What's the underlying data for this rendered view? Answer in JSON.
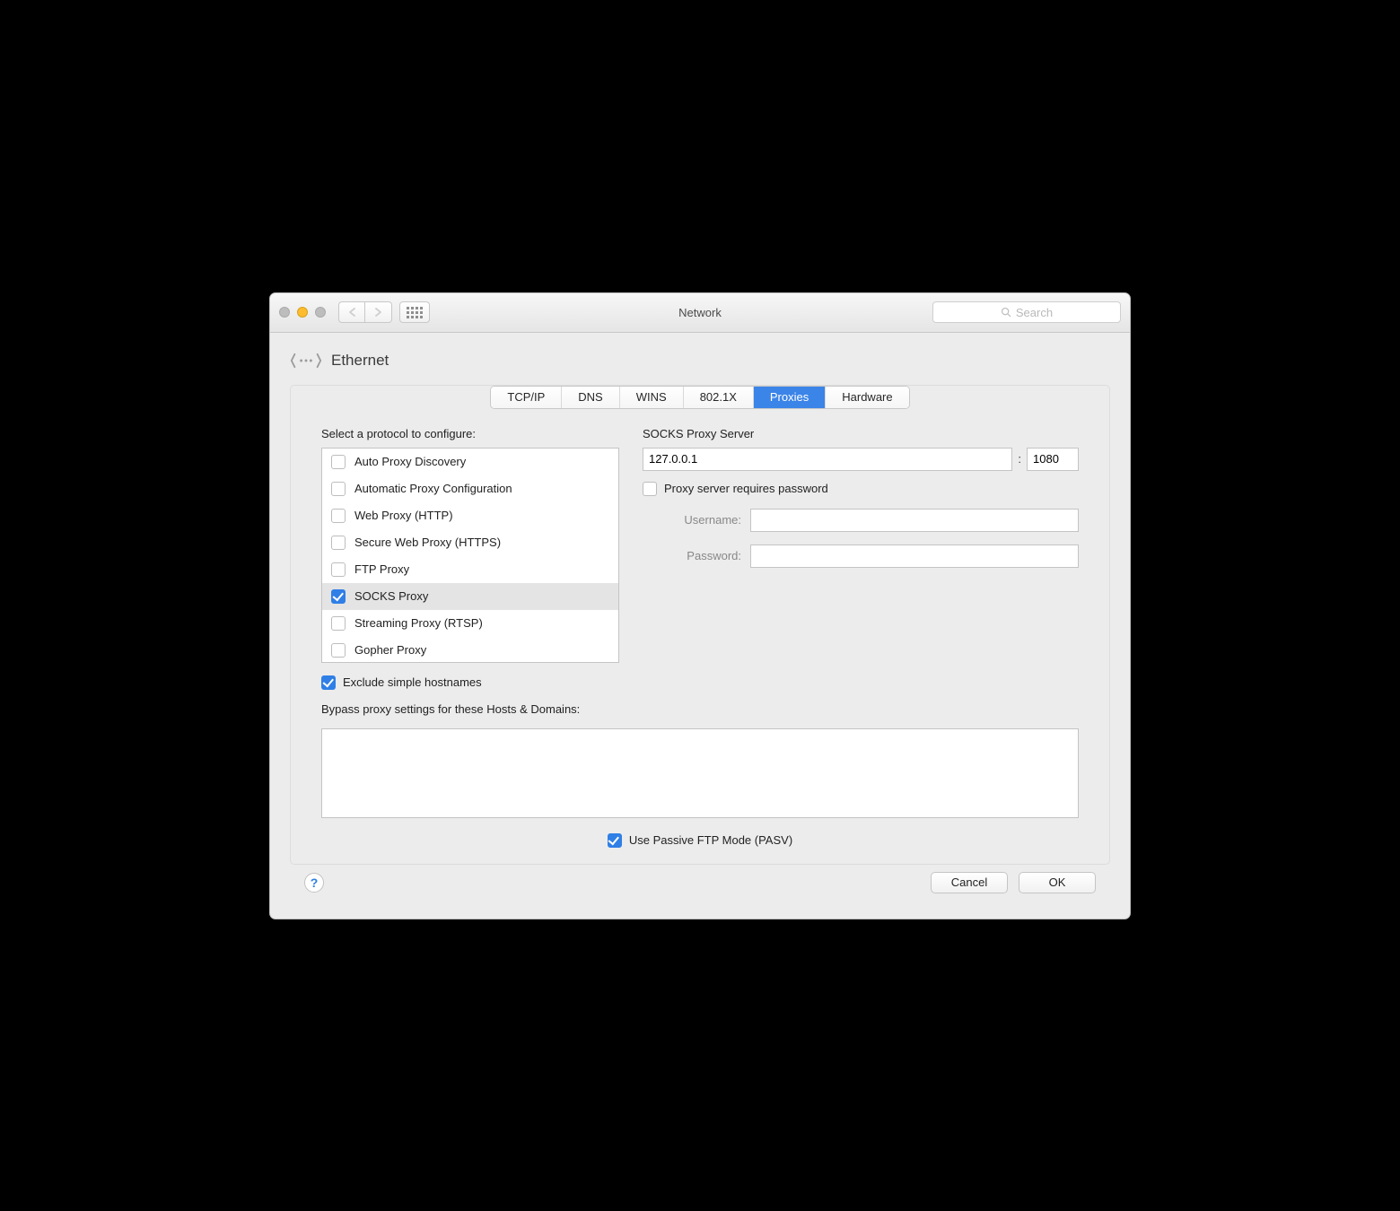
{
  "window": {
    "title": "Network",
    "search_placeholder": "Search"
  },
  "header": {
    "interface": "Ethernet"
  },
  "tabs": [
    {
      "label": "TCP/IP",
      "active": false
    },
    {
      "label": "DNS",
      "active": false
    },
    {
      "label": "WINS",
      "active": false
    },
    {
      "label": "802.1X",
      "active": false
    },
    {
      "label": "Proxies",
      "active": true
    },
    {
      "label": "Hardware",
      "active": false
    }
  ],
  "proxies": {
    "select_label": "Select a protocol to configure:",
    "protocols": [
      {
        "label": "Auto Proxy Discovery",
        "checked": false,
        "selected": false
      },
      {
        "label": "Automatic Proxy Configuration",
        "checked": false,
        "selected": false
      },
      {
        "label": "Web Proxy (HTTP)",
        "checked": false,
        "selected": false
      },
      {
        "label": "Secure Web Proxy (HTTPS)",
        "checked": false,
        "selected": false
      },
      {
        "label": "FTP Proxy",
        "checked": false,
        "selected": false
      },
      {
        "label": "SOCKS Proxy",
        "checked": true,
        "selected": true
      },
      {
        "label": "Streaming Proxy (RTSP)",
        "checked": false,
        "selected": false
      },
      {
        "label": "Gopher Proxy",
        "checked": false,
        "selected": false
      }
    ],
    "server_label": "SOCKS Proxy Server",
    "host": "127.0.0.1",
    "port": "1080",
    "separator": ":",
    "requires_password_label": "Proxy server requires password",
    "requires_password": false,
    "username_label": "Username:",
    "username": "",
    "password_label": "Password:",
    "password": "",
    "exclude_simple_label": "Exclude simple hostnames",
    "exclude_simple": true,
    "bypass_label": "Bypass proxy settings for these Hosts & Domains:",
    "bypass": "",
    "pasv_label": "Use Passive FTP Mode (PASV)",
    "pasv": true
  },
  "footer": {
    "help": "?",
    "cancel": "Cancel",
    "ok": "OK"
  }
}
